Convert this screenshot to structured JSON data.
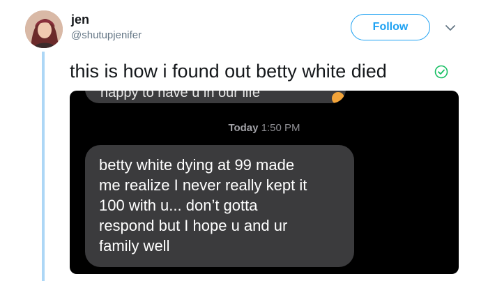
{
  "author": {
    "display_name": "jen",
    "handle": "@shutupjenifer"
  },
  "actions": {
    "follow_label": "Follow"
  },
  "icons": {
    "caret": "chevron-down-icon",
    "verified_check": "check-circle-icon"
  },
  "tweet": {
    "text": "this is how i found out betty white died"
  },
  "attached_screenshot": {
    "cut_message_text": "happy to have u in our life",
    "timestamp_day": "Today",
    "timestamp_time": "1:50 PM",
    "message_text": "betty white dying at 99 made\nme realize I never really kept it\n100 with u... don’t gotta\nrespond but I hope u and ur\nfamily well"
  },
  "colors": {
    "accent": "#1da1f2",
    "thread_line": "#add7f6",
    "check": "#17bf63",
    "bubble": "#3b3b3d"
  }
}
